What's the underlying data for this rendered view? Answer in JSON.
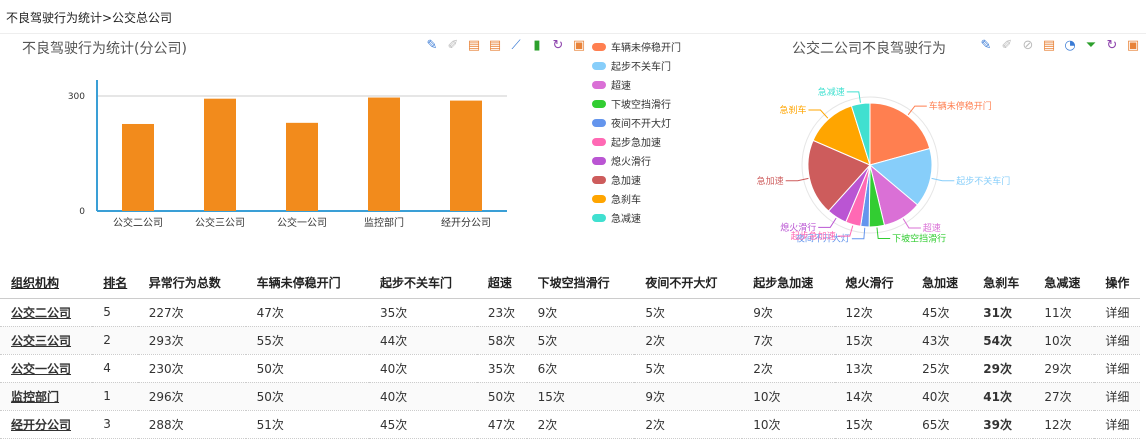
{
  "breadcrumb": "不良驾驶行为统计>公交总公司",
  "bar_chart": {
    "title": "不良驾驶行为统计(分公司)",
    "toolbar_icons": [
      "pencil-icon",
      "eraser-icon",
      "book-icon",
      "data-view-icon",
      "line-chart-icon",
      "bar-chart-icon",
      "refresh-icon",
      "save-icon"
    ]
  },
  "pie_chart": {
    "title": "公交二公司不良驾驶行为",
    "toolbar_icons": [
      "pencil-icon",
      "eraser-icon",
      "restore-icon",
      "data-view-icon",
      "pie-chart-icon",
      "funnel-icon",
      "refresh-icon",
      "save-icon"
    ]
  },
  "chart_data": [
    {
      "type": "bar",
      "title": "不良驾驶行为统计(分公司)",
      "categories": [
        "公交二公司",
        "公交三公司",
        "公交一公司",
        "监控部门",
        "经开分公司"
      ],
      "values": [
        227,
        293,
        230,
        296,
        288
      ],
      "ylim": [
        0,
        300
      ],
      "yticks": [
        0,
        300
      ],
      "color": "#f28b1c",
      "axis_color": "#3a9fd6"
    },
    {
      "type": "pie",
      "title": "公交二公司不良驾驶行为",
      "labels": [
        "车辆未停稳开门",
        "起步不关车门",
        "超速",
        "下坡空挡滑行",
        "夜间不开大灯",
        "起步急加速",
        "熄火滑行",
        "急加速",
        "急刹车",
        "急减速"
      ],
      "values": [
        47,
        35,
        23,
        9,
        5,
        9,
        12,
        45,
        31,
        11
      ],
      "colors": [
        "#ff7f50",
        "#87cefa",
        "#da70d6",
        "#32cd32",
        "#6495ed",
        "#ff69b4",
        "#ba55d3",
        "#cd5c5c",
        "#ffa500",
        "#40e0d0"
      ],
      "legend_position": "left"
    }
  ],
  "table": {
    "headers": [
      "组织机构",
      "排名",
      "异常行为总数",
      "车辆未停稳开门",
      "起步不关车门",
      "超速",
      "下坡空挡滑行",
      "夜间不开大灯",
      "起步急加速",
      "熄火滑行",
      "急加速",
      "急刹车",
      "急减速",
      "操作"
    ],
    "rows": [
      [
        "公交二公司",
        "5",
        "227次",
        "47次",
        "35次",
        "23次",
        "9次",
        "5次",
        "9次",
        "12次",
        "45次",
        "31次",
        "11次",
        "详细"
      ],
      [
        "公交三公司",
        "2",
        "293次",
        "55次",
        "44次",
        "58次",
        "5次",
        "2次",
        "7次",
        "15次",
        "43次",
        "54次",
        "10次",
        "详细"
      ],
      [
        "公交一公司",
        "4",
        "230次",
        "50次",
        "40次",
        "35次",
        "6次",
        "5次",
        "2次",
        "13次",
        "25次",
        "29次",
        "29次",
        "详细"
      ],
      [
        "监控部门",
        "1",
        "296次",
        "50次",
        "40次",
        "50次",
        "15次",
        "9次",
        "10次",
        "14次",
        "40次",
        "41次",
        "27次",
        "详细"
      ],
      [
        "经开分公司",
        "3",
        "288次",
        "51次",
        "45次",
        "47次",
        "2次",
        "2次",
        "10次",
        "15次",
        "65次",
        "39次",
        "12次",
        "详细"
      ]
    ]
  }
}
